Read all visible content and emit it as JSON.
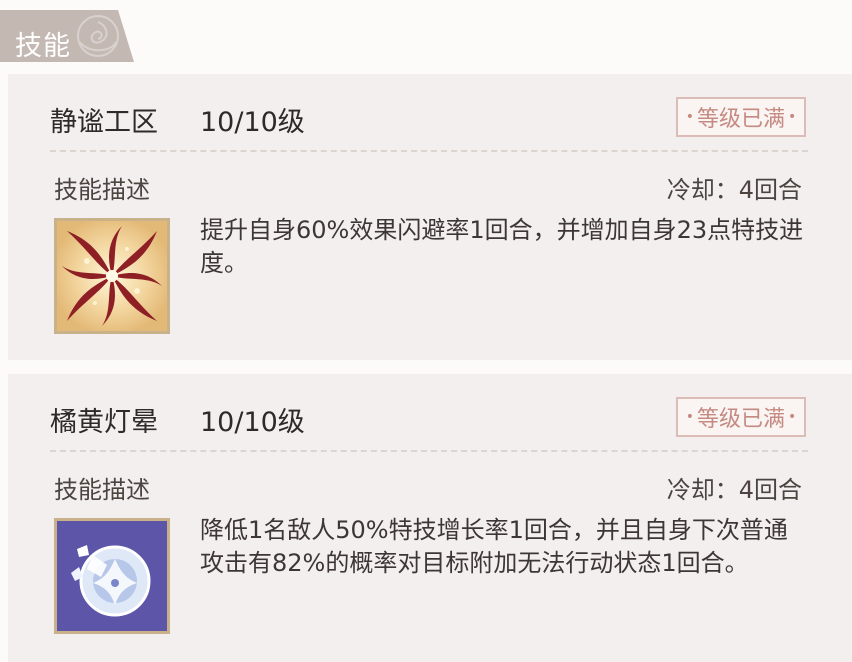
{
  "header": {
    "title": "技能",
    "decoration_icon": "rose-icon"
  },
  "skills": [
    {
      "name": "静谧工区",
      "level": "10/10级",
      "badge": "等级已满",
      "section_label": "技能描述",
      "cooldown": "冷却：4回合",
      "description": "提升自身60%效果闪避率1回合，并增加自身23点特技进度。",
      "icon": "swirl-skill-icon"
    },
    {
      "name": "橘黄灯晕",
      "level": "10/10级",
      "badge": "等级已满",
      "section_label": "技能描述",
      "cooldown": "冷却：4回合",
      "description": "降低1名敌人50%特技增长率1回合，并且自身下次普通攻击有82%的概率对目标附加无法行动状态1回合。",
      "icon": "crystal-skill-icon"
    }
  ],
  "colors": {
    "header_bg": "#c4b8b3",
    "card_bg": "#f3efee",
    "badge_text": "#c58a82",
    "badge_border": "#dcbcb6",
    "icon_border": "#c9b189"
  }
}
